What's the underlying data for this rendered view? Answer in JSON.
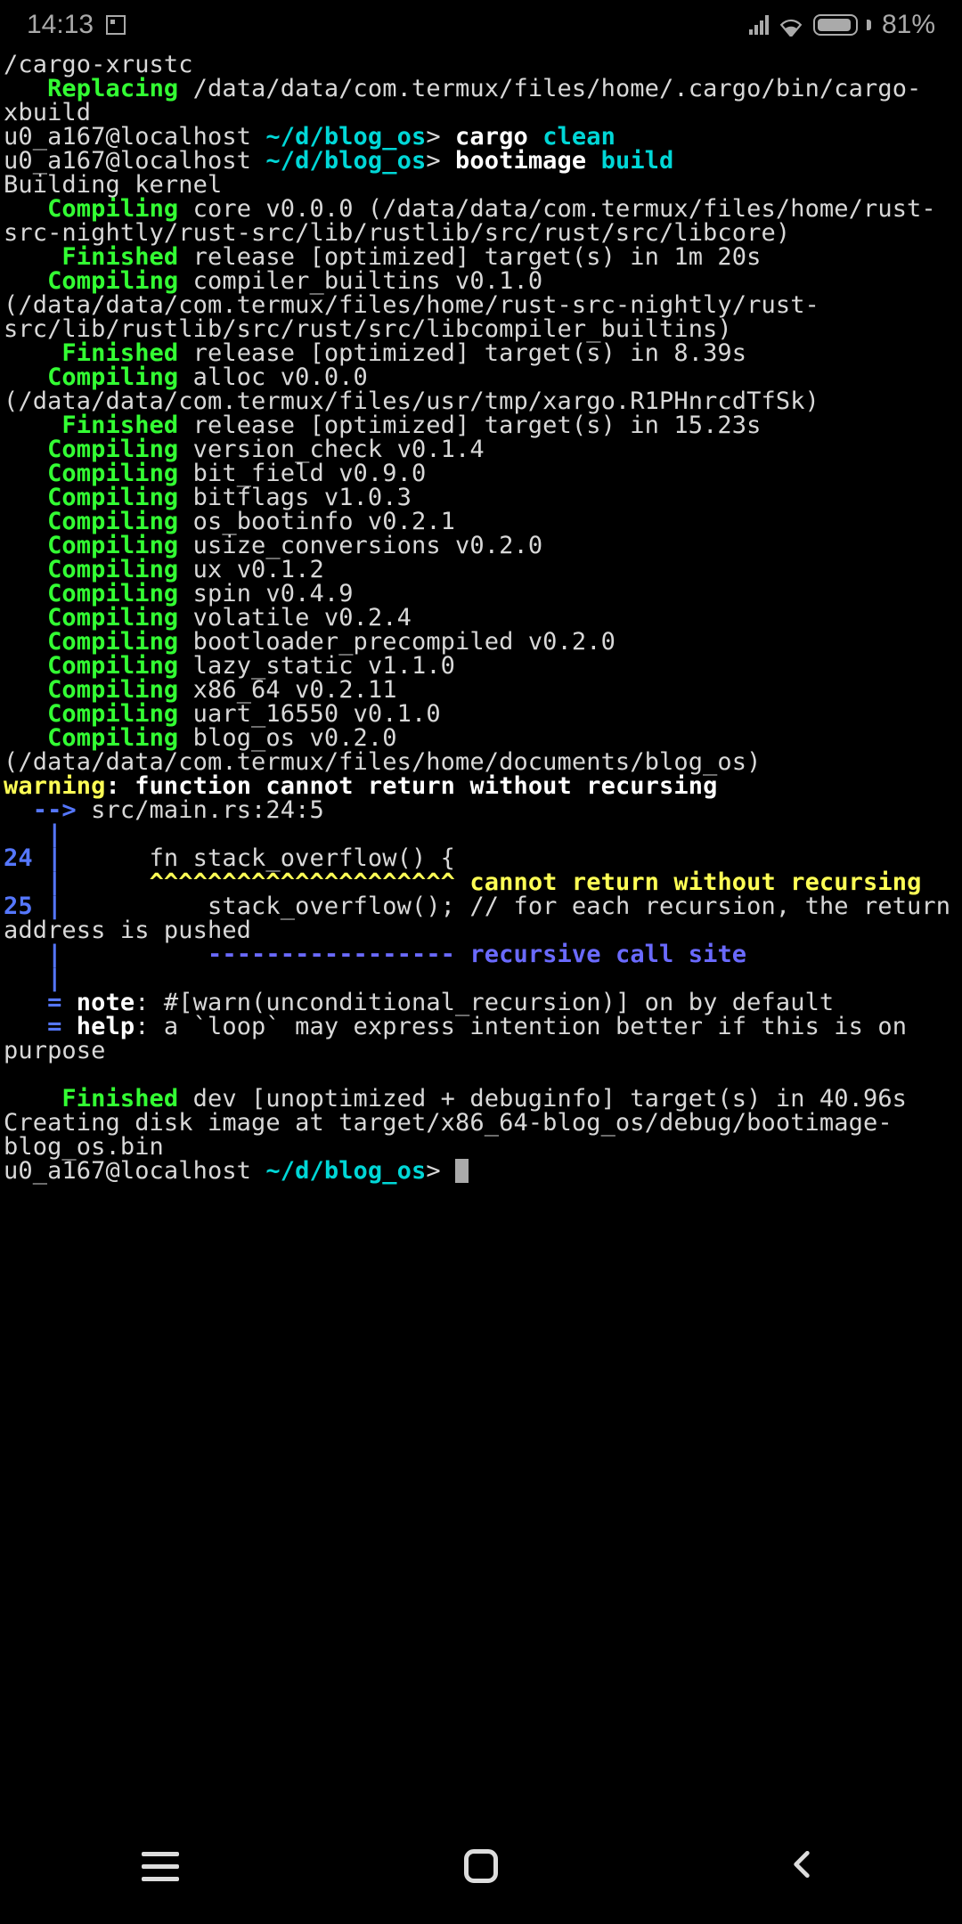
{
  "status": {
    "time": "14:13",
    "battery": "81%"
  },
  "term": {
    "l0": "/cargo-xrustc",
    "l1_kw": "   Replacing ",
    "l1_rest": "/data/data/com.termux/files/home/.cargo/bin/cargo-xbuild",
    "p1_user": "u0_a167@localhost ",
    "p1_path": "~/d/blog_os",
    "p1_gt": "> ",
    "p1_cmd": "cargo ",
    "p1_arg": "clean",
    "p2_cmd": "bootimage ",
    "p2_arg": "build",
    "l4": "Building kernel",
    "c_core_kw": "   Compiling ",
    "c_core": "core v0.0.0 (/data/data/com.termux/files/home/rust-src-nightly/rust-src/lib/rustlib/src/rust/src/libcore)",
    "fin1_kw": "    Finished ",
    "fin1": "release [optimized] target(s) in 1m 20s",
    "c_cb": "compiler_builtins v0.1.0 (/data/data/com.termux/files/home/rust-src-nightly/rust-src/lib/rustlib/src/rust/src/libcompiler_builtins)",
    "fin2": "release [optimized] target(s) in 8.39s",
    "c_alloc": "alloc v0.0.0 (/data/data/com.termux/files/usr/tmp/xargo.R1PHnrcdTfSk)",
    "fin3": "release [optimized] target(s) in 15.23s",
    "c_vc": "version_check v0.1.4",
    "c_bf": "bit_field v0.9.0",
    "c_bfl": "bitflags v1.0.3",
    "c_obi": "os_bootinfo v0.2.1",
    "c_uc": "usize_conversions v0.2.0",
    "c_ux": "ux v0.1.2",
    "c_sp": "spin v0.4.9",
    "c_vol": "volatile v0.2.4",
    "c_bp": "bootloader_precompiled v0.2.0",
    "c_ls": "lazy_static v1.1.0",
    "c_x86": "x86_64 v0.2.11",
    "c_uart": "uart_16550 v0.1.0",
    "c_blog": "blog_os v0.2.0 (/data/data/com.termux/files/home/documents/blog_os)",
    "warn_kw": "warning",
    "warn_colon": ": ",
    "warn_msg": "function cannot return without recursing",
    "loc_arrow": "  --> ",
    "loc": "src/main.rs:24:5",
    "bar": "   |",
    "ln24": "24 ",
    "barln": "| ",
    "code24": "     fn stack_overflow() {",
    "caret_pre": "   | ",
    "caret": "     ^^^^^^^^^^^^^^^^^^^^^ ",
    "caret_msg": "cannot return without recursing",
    "ln25": "25 ",
    "code25": "         stack_overflow(); // for each recursion, the return address is pushed",
    "dash_pre": "   | ",
    "dash": "         ----------------- ",
    "dash_msg": "recursive call site",
    "eq_pre": "   = ",
    "note_kw": "note",
    "note_rest": ": #[warn(unconditional_recursion)] on by default",
    "help_kw": "help",
    "help_rest": ": a `loop` may express intention better if this is on purpose",
    "fin_dev": "dev [unoptimized + debuginfo] target(s) in 40.96s",
    "disk": "Creating disk image at target/x86_64-blog_os/debug/bootimage-blog_os.bin"
  }
}
